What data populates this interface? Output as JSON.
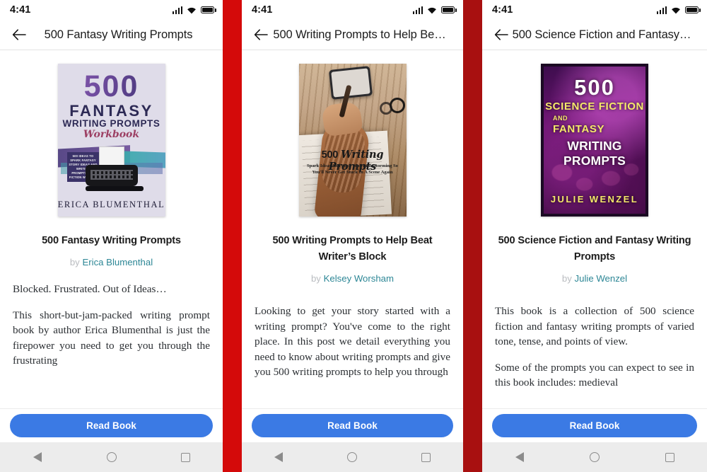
{
  "theme": {
    "divider_red": "#c80c0c",
    "button_blue": "#3b7ae4",
    "author_link_teal": "#2d8796",
    "navbar_grey": "#ececec"
  },
  "status_bar": {
    "time": "4:41",
    "icons": [
      "signal-icon",
      "wifi-icon",
      "battery-icon"
    ]
  },
  "nav_bar": {
    "back_label": "back-icon",
    "home_label": "home-icon",
    "recents_label": "recents-icon"
  },
  "panels": [
    {
      "appbar_title": "500 Fantasy Writing Prompts",
      "cover": {
        "number": "500",
        "line2": "FANTASY",
        "line3": "WRITING PROMPTS",
        "line4": "Workbook",
        "badge": "500 IDEAS TO SPARK FANTASY STORY IDEAS AND WRITING PROMPTS FOR FICTION WRITERS",
        "badge_highlight": "FICTION",
        "author": "ERICA BLUMENTHAL"
      },
      "title": "500 Fantasy Writing Prompts",
      "by_label": "by",
      "author": "Erica Blumenthal",
      "paragraphs": [
        "Blocked. Frustrated. Out of Ideas…",
        "This short-but-jam-packed writing prompt book by author Erica Blumenthal is just the firepower you need to get you through the frustrating"
      ],
      "read_button": "Read Book"
    },
    {
      "appbar_title": "500 Writing Prompts to Help Be…",
      "cover": {
        "headline": "500 Writing Prompts",
        "headline_plain": "500 ",
        "headline_script": "Writing Prompts",
        "subtitle": "Spark Ideas And Seed Your Brainstorming So You'll Never Get Stuck In A Scene Again"
      },
      "title": "500 Writing Prompts to Help Beat Writer’s Block",
      "by_label": "by",
      "author": "Kelsey Worsham",
      "paragraphs": [
        "Looking to get your story started with a writing prompt? You've come to the right place. In this post we detail everything you need to know about writing prompts and give you 500 writing prompts to help you through"
      ],
      "read_button": "Read Book"
    },
    {
      "appbar_title": "500 Science Fiction and Fantasy…",
      "cover": {
        "number": "500",
        "line2": "SCIENCE FICTION",
        "line3": "AND",
        "line4": "FANTASY",
        "line5": "WRITING PROMPTS",
        "author": "JULIE WENZEL"
      },
      "title": "500 Science Fiction and Fantasy Writing Prompts",
      "by_label": "by",
      "author": "Julie Wenzel",
      "paragraphs": [
        "This book is a collection of 500 science fiction and fantasy writing prompts of varied tone, tense, and points of view.",
        "Some of the prompts you can expect to see in this book includes: medieval"
      ],
      "read_button": "Read Book"
    }
  ]
}
